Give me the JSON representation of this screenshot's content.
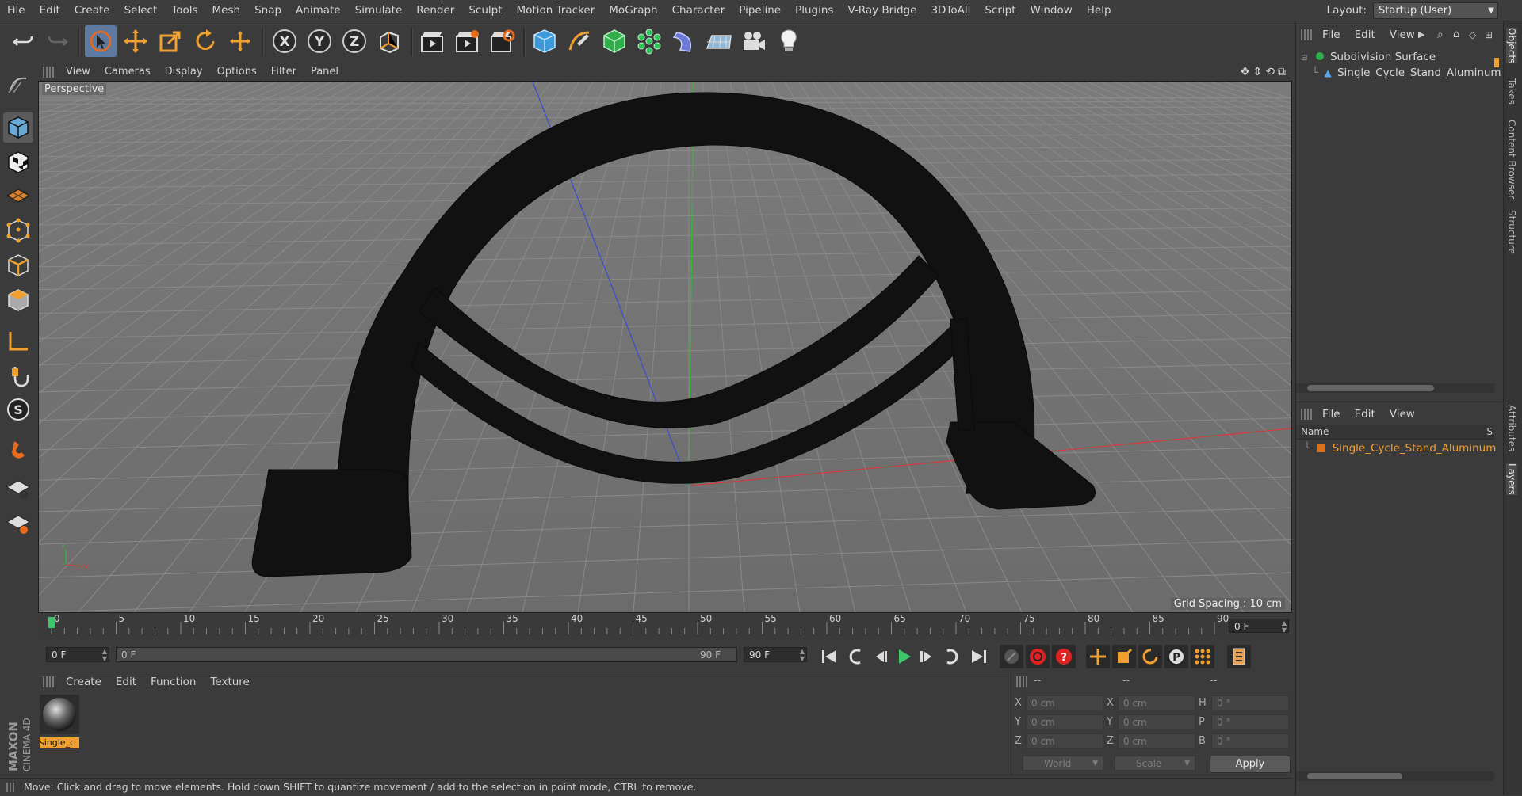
{
  "menubar": {
    "items": [
      "File",
      "Edit",
      "Create",
      "Select",
      "Tools",
      "Mesh",
      "Snap",
      "Animate",
      "Simulate",
      "Render",
      "Sculpt",
      "Motion Tracker",
      "MoGraph",
      "Character",
      "Pipeline",
      "Plugins",
      "V-Ray Bridge",
      "3DToAll",
      "Script",
      "Window",
      "Help"
    ],
    "layout_label": "Layout:",
    "layout_value": "Startup (User)"
  },
  "toolbar": {
    "icons": [
      "undo-icon",
      "redo-icon",
      "live-selection-icon",
      "move-icon",
      "scale-icon",
      "rotate-icon",
      "last-tool-icon",
      "x-axis-icon",
      "y-axis-icon",
      "z-axis-icon",
      "world-coordinates-icon",
      "render-view-icon",
      "render-picture-viewer-icon",
      "edit-render-settings-icon",
      "cube-icon",
      "pen-spline-icon",
      "subdivision-surface-icon",
      "cloner-icon",
      "deformer-icon",
      "floor-icon",
      "camera-icon",
      "light-icon"
    ],
    "axis_labels": [
      "X",
      "Y",
      "Z"
    ]
  },
  "viewport": {
    "menu": [
      "View",
      "Cameras",
      "Display",
      "Options",
      "Filter",
      "Panel"
    ],
    "label": "Perspective",
    "grid_spacing": "Grid Spacing : 10 cm"
  },
  "timeline": {
    "ticks": [
      "0",
      "5",
      "10",
      "15",
      "20",
      "25",
      "30",
      "35",
      "40",
      "45",
      "50",
      "55",
      "60",
      "65",
      "70",
      "75",
      "80",
      "85",
      "90"
    ],
    "current_frame": "0 F"
  },
  "transport": {
    "start_field": "0 F",
    "range_start": "0 F",
    "range_end": "90 F",
    "end_field": "90 F"
  },
  "material_manager": {
    "menu": [
      "Create",
      "Edit",
      "Function",
      "Texture"
    ],
    "material_name": "single_c"
  },
  "coordinates": {
    "headers": [
      "--",
      "--",
      "--"
    ],
    "rows": [
      {
        "l1": "X",
        "v1": "0 cm",
        "l2": "X",
        "v2": "0 cm",
        "l3": "H",
        "v3": "0 °"
      },
      {
        "l1": "Y",
        "v1": "0 cm",
        "l2": "Y",
        "v2": "0 cm",
        "l3": "P",
        "v3": "0 °"
      },
      {
        "l1": "Z",
        "v1": "0 cm",
        "l2": "Z",
        "v2": "0 cm",
        "l3": "B",
        "v3": "0 °"
      }
    ],
    "mode1": "World",
    "mode2": "Scale",
    "apply": "Apply"
  },
  "status": {
    "text": "Move: Click and drag to move elements. Hold down SHIFT to quantize movement / add to the selection in point mode, CTRL to remove."
  },
  "logo": {
    "line1": "MAXON",
    "line2": "CINEMA 4D"
  },
  "object_manager": {
    "menu": [
      "File",
      "Edit",
      "View"
    ],
    "objects": [
      {
        "name": "Subdivision Surface",
        "icon": "subdivision-surface-icon"
      },
      {
        "name": "Single_Cycle_Stand_Aluminum",
        "icon": "polygon-object-icon"
      }
    ]
  },
  "layer_manager": {
    "menu": [
      "File",
      "Edit",
      "View"
    ],
    "column_name": "Name",
    "column_s": "S",
    "layers": [
      "Single_Cycle_Stand_Aluminum"
    ]
  },
  "side_tabs": [
    "Objects",
    "Takes",
    "Content Browser",
    "Structure",
    "Attributes",
    "Layers"
  ],
  "colors": {
    "selection_blue": "#5e7aa0",
    "layer_orange": "#f0a030",
    "playhead_green": "#3ec76a",
    "axis_x": "#d23b3b",
    "axis_y": "#33bb33",
    "axis_z": "#3b4bd2"
  }
}
